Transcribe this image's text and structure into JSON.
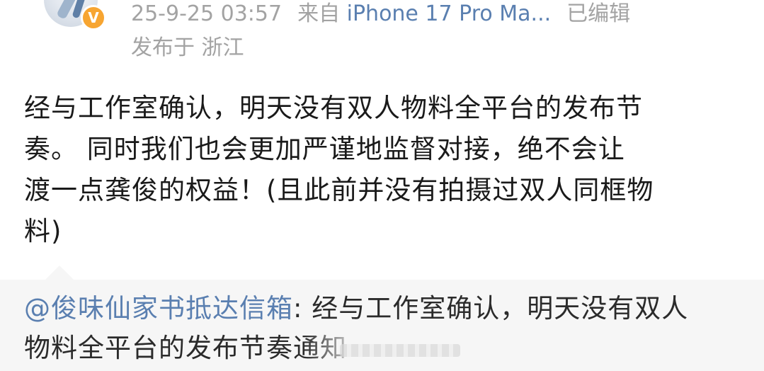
{
  "header": {
    "verified_badge": "V",
    "timestamp": "25-9-25 03:57",
    "source_prefix": "来自",
    "device": "iPhone 17 Pro Ma...",
    "edited": "已编辑",
    "location": "发布于 浙江"
  },
  "post": {
    "lines": [
      "经与工作室确认，明天没有双人物料全平台的发布节",
      "奏。 同时我们也会更加严谨地监督对接，绝不会让",
      "渡一点龚俊的权益！(且此前并没有拍摄过双人同框物",
      "料)"
    ]
  },
  "repost": {
    "mention": "@俊味仙家书抵达信箱",
    "line1_rest": ": 经与工作室确认，明天没有双人",
    "line2": "物料全平台的发布节奏通知"
  },
  "colors": {
    "link": "#5a7fb0",
    "meta": "#a3a3a3",
    "badge": "#f7a531",
    "repost_bg": "#f6f6f6"
  },
  "icons": {
    "verified": "verified-badge-icon",
    "avatar": "avatar-image"
  }
}
